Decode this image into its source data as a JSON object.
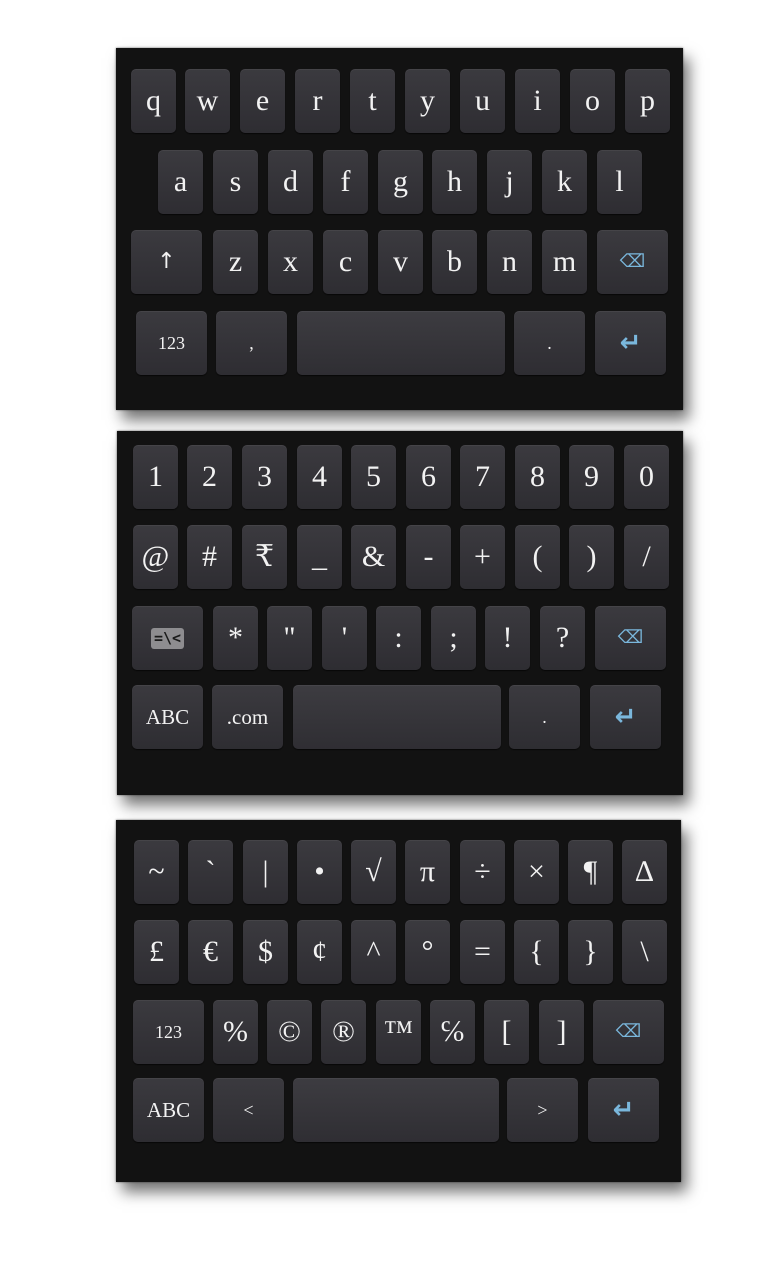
{
  "alpha_keyboard": {
    "row1": [
      "q",
      "w",
      "e",
      "r",
      "t",
      "y",
      "u",
      "i",
      "o",
      "p"
    ],
    "row2": [
      "a",
      "s",
      "d",
      "f",
      "g",
      "h",
      "j",
      "k",
      "l"
    ],
    "row3": [
      "z",
      "x",
      "c",
      "v",
      "b",
      "n",
      "m"
    ],
    "shift_glyph": "↑",
    "backspace_glyph": "⌫",
    "mode_label": "123",
    "comma_label": ",",
    "period_label": ".",
    "enter_glyph": "↵"
  },
  "numeric_keyboard": {
    "row1": [
      "1",
      "2",
      "3",
      "4",
      "5",
      "6",
      "7",
      "8",
      "9",
      "0"
    ],
    "row2": [
      "@",
      "#",
      "₹",
      "_",
      "&",
      "-",
      "+",
      "(",
      ")",
      "/"
    ],
    "row3": [
      "*",
      "\"",
      "'",
      ":",
      ";",
      "!",
      "?"
    ],
    "more_symbols_label": "=\\<",
    "backspace_glyph": "⌫",
    "abc_label": "ABC",
    "dotcom_label": ".com",
    "period_label": ".",
    "enter_glyph": "↵"
  },
  "symbol_keyboard": {
    "row1": [
      "~",
      "`",
      "|",
      "•",
      "√",
      "π",
      "÷",
      "×",
      "¶",
      "∆"
    ],
    "row2": [
      "£",
      "€",
      "$",
      "¢",
      "^",
      "°",
      "=",
      "{",
      "}",
      "\\"
    ],
    "row3": [
      "%",
      "©",
      "®",
      "™",
      "℅",
      "[",
      "]"
    ],
    "numbers_label": "123",
    "backspace_glyph": "⌫",
    "abc_label": "ABC",
    "less_than_label": "<",
    "greater_than_label": ">",
    "enter_glyph": "↵"
  },
  "colors": {
    "keyboard_bg": "#121212",
    "key_bg": "#35343a",
    "key_text": "#f2f2f2",
    "accent": "#7ab7dc"
  }
}
